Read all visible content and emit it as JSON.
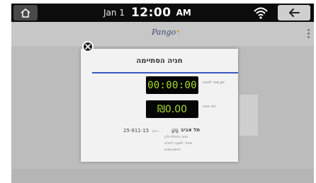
{
  "status_bar": {
    "date": "Jan 1",
    "time": "12:00",
    "ampm": "AM",
    "icons": [
      "home-icon",
      "wifi-icon",
      "back-arrow-icon"
    ]
  },
  "app": {
    "logo_main": "Pango",
    "logo_dot": "•"
  },
  "dialog": {
    "title": "חניה הסתיימה",
    "timer_value": "00:00:00",
    "timer_label": "זמן מכר לחניה",
    "cost_value": "₪0.00",
    "cost_label": "דמי חניה",
    "plate": "25-911-15",
    "plate_label": "רכב:",
    "city": "תל אביב",
    "details": [
      "חניה כחולה-לבן",
      "מחיר לשעה לחניה",
      "ראשון-שישי"
    ]
  },
  "colors": {
    "accent": "#3b59c2",
    "digit": "#a8df2c",
    "status_bar": "#0c0c0c"
  }
}
